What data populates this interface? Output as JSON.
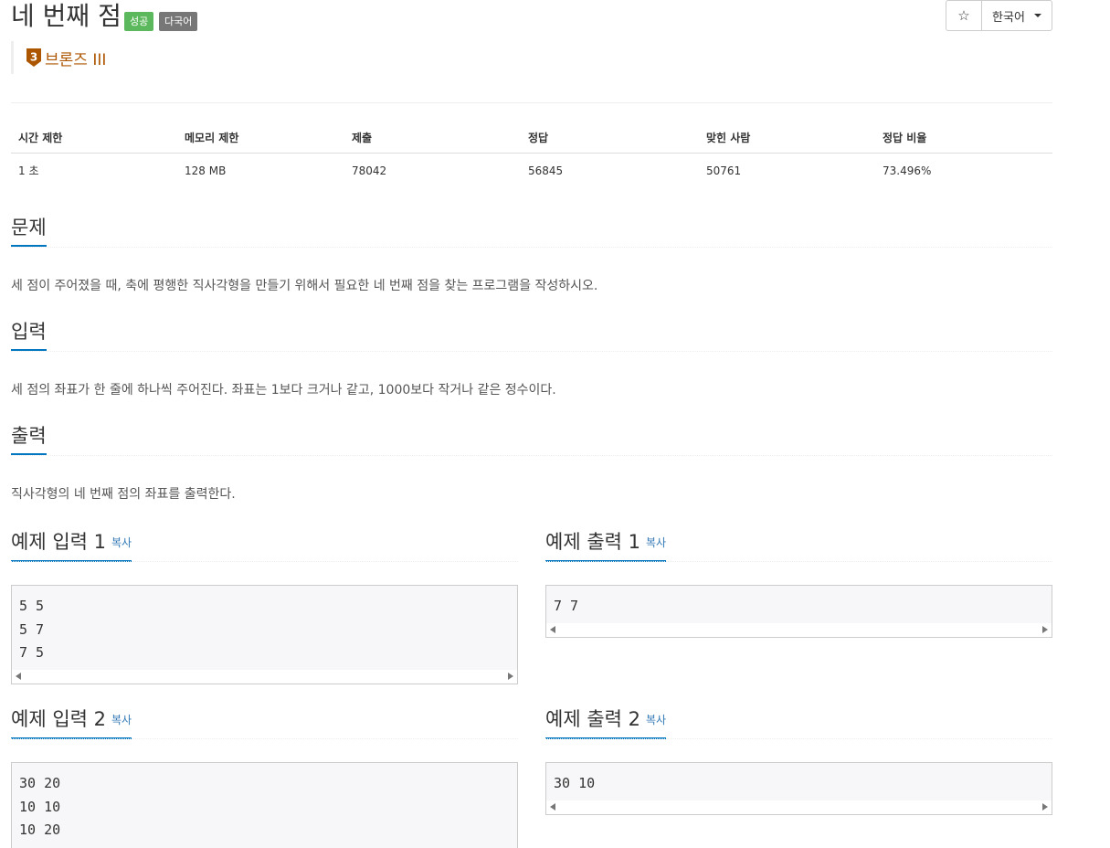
{
  "header": {
    "title": "네 번째 점",
    "badges": [
      "성공",
      "다국어"
    ],
    "star_icon": "star-icon",
    "language": "한국어",
    "tier": "브론즈 III",
    "tier_level": "3",
    "tier_color": "#ad5600"
  },
  "info": {
    "headers": [
      "시간 제한",
      "메모리 제한",
      "제출",
      "정답",
      "맞힌 사람",
      "정답 비율"
    ],
    "values": [
      "1 초",
      "128 MB",
      "78042",
      "56845",
      "50761",
      "73.496%"
    ]
  },
  "problem": {
    "title": "문제",
    "text": "세 점이 주어졌을 때, 축에 평행한 직사각형을 만들기 위해서 필요한 네 번째 점을 찾는 프로그램을 작성하시오."
  },
  "input": {
    "title": "입력",
    "text": "세 점의 좌표가 한 줄에 하나씩 주어진다. 좌표는 1보다 크거나 같고, 1000보다 작거나 같은 정수이다."
  },
  "output": {
    "title": "출력",
    "text": "직사각형의 네 번째 점의 좌표를 출력한다."
  },
  "examples": {
    "copy_label": "복사",
    "input1_title": "예제 입력 1",
    "output1_title": "예제 출력 1",
    "input2_title": "예제 입력 2",
    "output2_title": "예제 출력 2",
    "input1": [
      "5 5",
      "5 7",
      "7 5"
    ],
    "output1": [
      "7 7"
    ],
    "input2": [
      "30 20",
      "10 10",
      "10 20"
    ],
    "output2": [
      "30 10"
    ]
  }
}
